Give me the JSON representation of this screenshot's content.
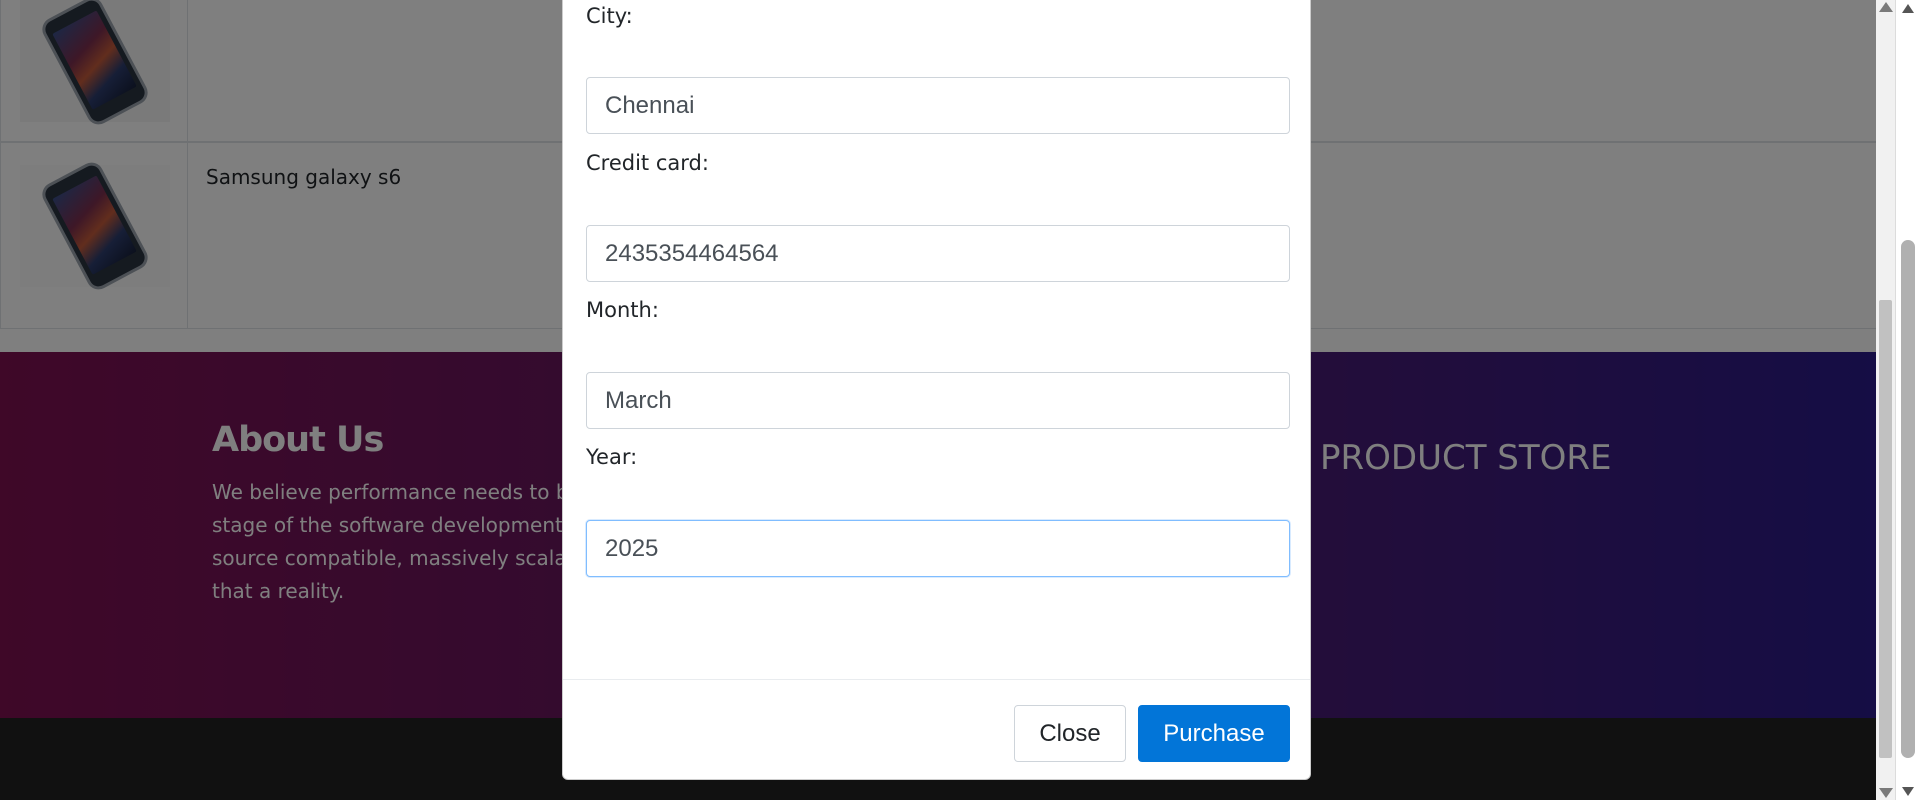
{
  "cart": {
    "rows": [
      {
        "image": "samsung-galaxy-s6-image"
      },
      {
        "image": "samsung-galaxy-s6-image",
        "title": "Samsung galaxy s6"
      }
    ]
  },
  "footer": {
    "about_heading": "About Us",
    "about_lines": [
      "We believe performance needs to be",
      "stage of the software development c",
      "source compatible, massively scalabl",
      "that a reality."
    ],
    "brand": "PRODUCT STORE"
  },
  "modal": {
    "fields": {
      "city": {
        "label": "City:",
        "value": "Chennai"
      },
      "credit_card": {
        "label": "Credit card:",
        "value": "2435354464564"
      },
      "month": {
        "label": "Month:",
        "value": "March"
      },
      "year": {
        "label": "Year:",
        "value": "2025"
      }
    },
    "buttons": {
      "close": "Close",
      "purchase": "Purchase"
    }
  },
  "colors": {
    "primary": "#0275d8",
    "footer_gradient_start": "#7e1051",
    "footer_gradient_end": "#2a1a8a",
    "bottom_bar": "#222222"
  }
}
